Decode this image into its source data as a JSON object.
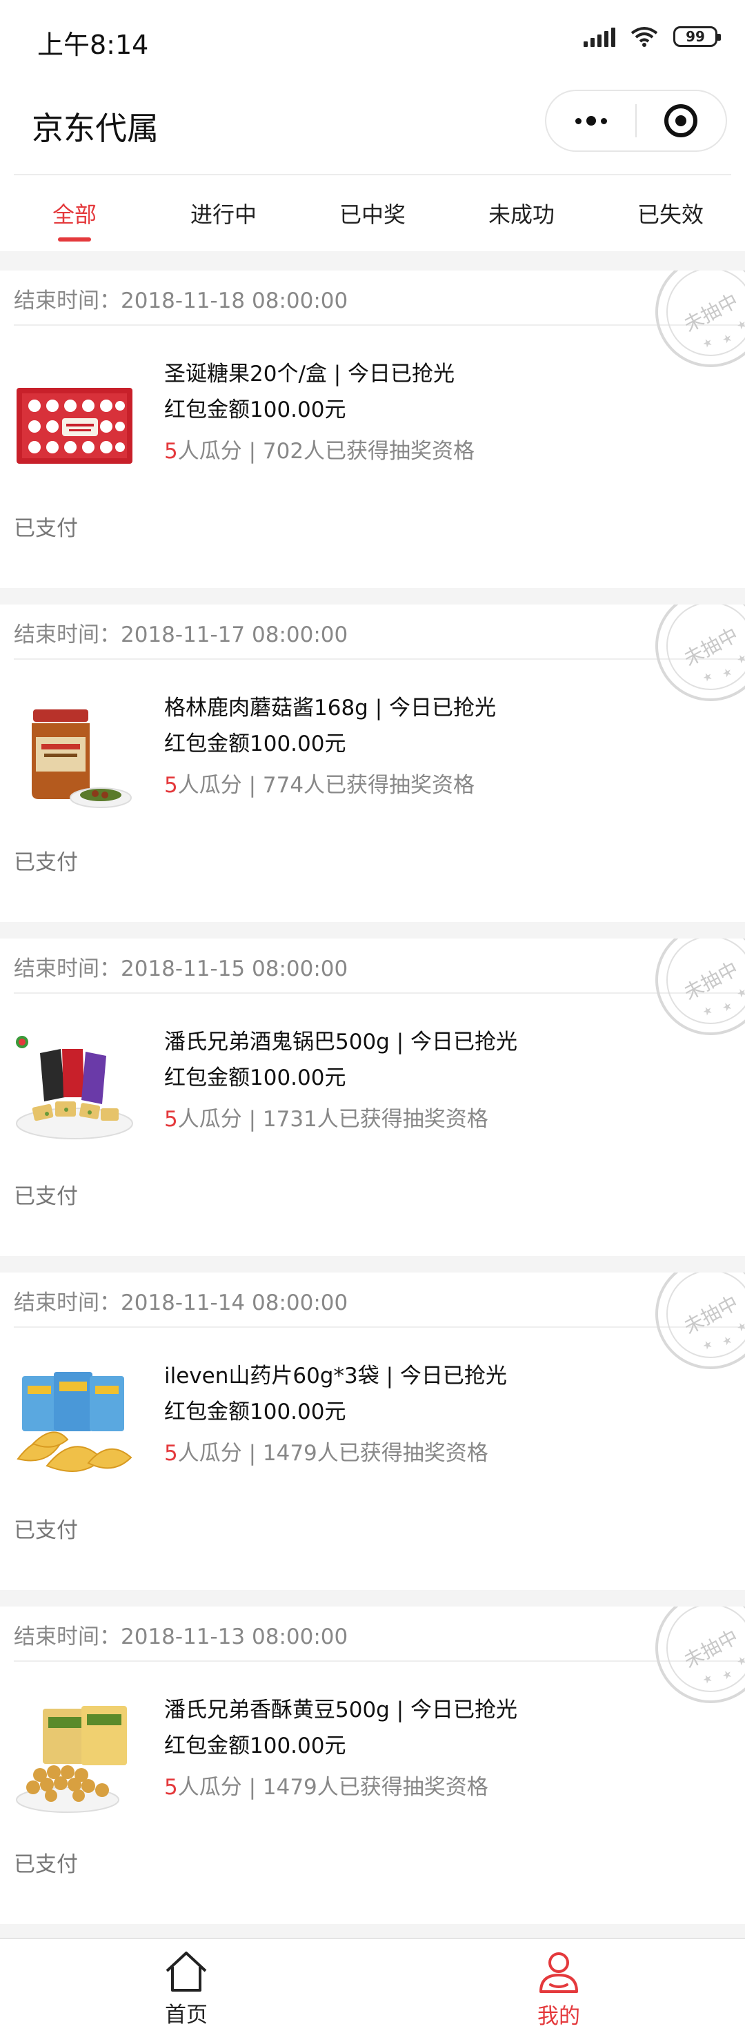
{
  "status_bar": {
    "time": "上午8:14",
    "battery": "99"
  },
  "nav": {
    "title": "京东代属"
  },
  "tabs": [
    {
      "label": "全部",
      "active": true
    },
    {
      "label": "进行中",
      "active": false
    },
    {
      "label": "已中奖",
      "active": false
    },
    {
      "label": "未成功",
      "active": false
    },
    {
      "label": "已失效",
      "active": false
    }
  ],
  "stamp_text": "未抽中",
  "items": [
    {
      "end_time": "结束时间：2018-11-18 08:00:00",
      "name": "圣诞糖果20个/盒 | 今日已抢光",
      "amount": "红包金额100.00元",
      "share_count": "5",
      "meta": "人瓜分 | 702人已获得抽奖资格",
      "status": "已支付"
    },
    {
      "end_time": "结束时间：2018-11-17 08:00:00",
      "name": "格林鹿肉蘑菇酱168g | 今日已抢光",
      "amount": "红包金额100.00元",
      "share_count": "5",
      "meta": "人瓜分 | 774人已获得抽奖资格",
      "status": "已支付"
    },
    {
      "end_time": "结束时间：2018-11-15 08:00:00",
      "name": "潘氏兄弟酒鬼锅巴500g | 今日已抢光",
      "amount": "红包金额100.00元",
      "share_count": "5",
      "meta": "人瓜分 | 1731人已获得抽奖资格",
      "status": "已支付"
    },
    {
      "end_time": "结束时间：2018-11-14 08:00:00",
      "name": "ileven山药片60g*3袋 | 今日已抢光",
      "amount": "红包金额100.00元",
      "share_count": "5",
      "meta": "人瓜分 | 1479人已获得抽奖资格",
      "status": "已支付"
    },
    {
      "end_time": "结束时间：2018-11-13 08:00:00",
      "name": "潘氏兄弟香酥黄豆500g | 今日已抢光",
      "amount": "红包金额100.00元",
      "share_count": "5",
      "meta": "人瓜分 | 1479人已获得抽奖资格",
      "status": "已支付"
    }
  ],
  "tabbar": {
    "home_label": "首页",
    "mine_label": "我的",
    "active": "mine"
  },
  "colors": {
    "accent": "#e4393c",
    "muted_text": "#888888",
    "background": "#f4f4f4"
  }
}
